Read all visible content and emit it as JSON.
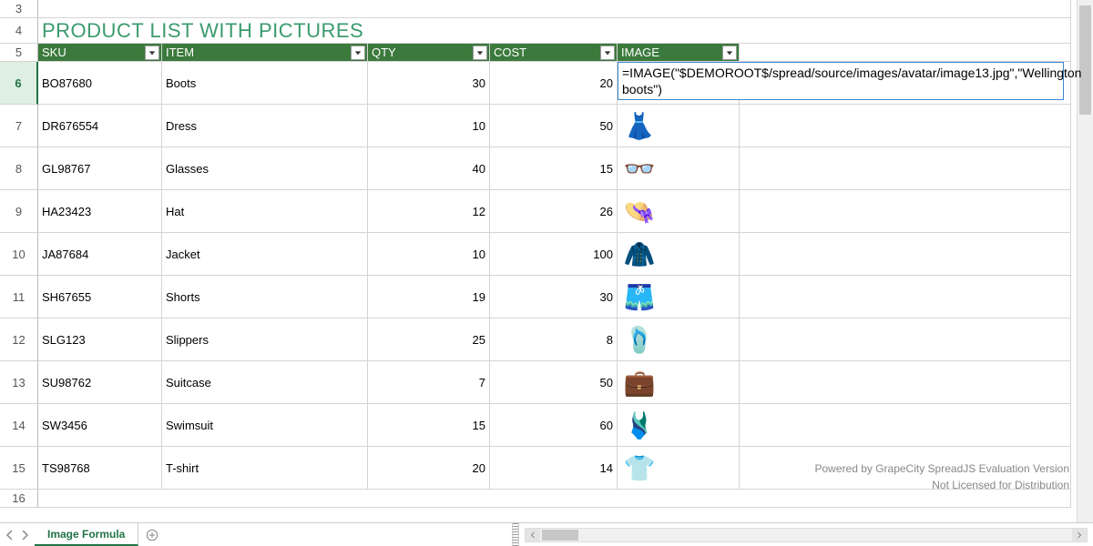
{
  "title": "PRODUCT LIST WITH PICTURES",
  "columns": {
    "sku": "SKU",
    "item": "ITEM",
    "qty": "QTY",
    "cost": "COST",
    "image": "IMAGE"
  },
  "row_numbers": [
    "3",
    "4",
    "5",
    "6",
    "7",
    "8",
    "9",
    "10",
    "11",
    "12",
    "13",
    "14",
    "15",
    "16"
  ],
  "products": [
    {
      "sku": "BO87680",
      "item": "Boots",
      "qty": "30",
      "cost": "20",
      "icon": "boots-icon",
      "glyph": ""
    },
    {
      "sku": "DR676554",
      "item": "Dress",
      "qty": "10",
      "cost": "50",
      "icon": "dress-icon",
      "glyph": "👗"
    },
    {
      "sku": "GL98767",
      "item": "Glasses",
      "qty": "40",
      "cost": "15",
      "icon": "glasses-icon",
      "glyph": "👓"
    },
    {
      "sku": "HA23423",
      "item": "Hat",
      "qty": "12",
      "cost": "26",
      "icon": "hat-icon",
      "glyph": "👒"
    },
    {
      "sku": "JA87684",
      "item": "Jacket",
      "qty": "10",
      "cost": "100",
      "icon": "jacket-icon",
      "glyph": "🧥"
    },
    {
      "sku": "SH67655",
      "item": "Shorts",
      "qty": "19",
      "cost": "30",
      "icon": "shorts-icon",
      "glyph": "🩳"
    },
    {
      "sku": "SLG123",
      "item": "Slippers",
      "qty": "25",
      "cost": "8",
      "icon": "slippers-icon",
      "glyph": "🩴"
    },
    {
      "sku": "SU98762",
      "item": "Suitcase",
      "qty": "7",
      "cost": "50",
      "icon": "suitcase-icon",
      "glyph": "💼"
    },
    {
      "sku": "SW3456",
      "item": "Swimsuit",
      "qty": "15",
      "cost": "60",
      "icon": "swimsuit-icon",
      "glyph": "🩱"
    },
    {
      "sku": "TS98768",
      "item": "T-shirt",
      "qty": "20",
      "cost": "14",
      "icon": "tshirt-icon",
      "glyph": "👕"
    }
  ],
  "active_row_index": 6,
  "formula_overlay": "=IMAGE(\"$DEMOROOT$/spread/source/images/avatar/image13.jpg\",\"Wellington boots\")",
  "sheet_tab": "Image Formula",
  "watermark": {
    "line1": "Powered by GrapeCity SpreadJS Evaluation Version",
    "line2": "Not Licensed for Distribution"
  }
}
